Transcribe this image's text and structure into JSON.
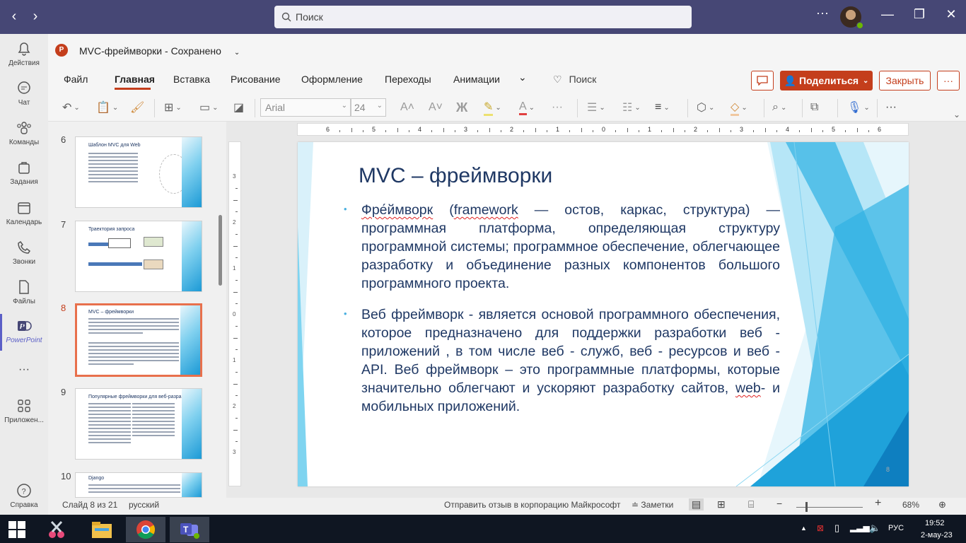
{
  "titlebar": {
    "search_placeholder": "Поиск",
    "more": "···"
  },
  "rail": {
    "items": [
      {
        "label": "Действия",
        "icon": "bell-icon"
      },
      {
        "label": "Чат",
        "icon": "chat-icon"
      },
      {
        "label": "Команды",
        "icon": "teams-icon"
      },
      {
        "label": "Задания",
        "icon": "assignments-icon"
      },
      {
        "label": "Календарь",
        "icon": "calendar-icon"
      },
      {
        "label": "Звонки",
        "icon": "phone-icon"
      },
      {
        "label": "Файлы",
        "icon": "file-icon"
      },
      {
        "label": "PowerPoint",
        "icon": "powerpoint-icon"
      },
      {
        "label": "···",
        "icon": "more-icon"
      },
      {
        "label": "Приложен...",
        "icon": "apps-icon"
      },
      {
        "label": "Справка",
        "icon": "help-icon"
      }
    ]
  },
  "document": {
    "title": "MVC-фреймворки",
    "separator": "-",
    "status": "Сохранено"
  },
  "ribbon": {
    "tabs": [
      "Файл",
      "Главная",
      "Вставка",
      "Рисование",
      "Оформление",
      "Переходы",
      "Анимации"
    ],
    "tell_me": "Поиск",
    "share": "Поделиться",
    "close": "Закрыть",
    "font_name": "Arial",
    "font_size": "24",
    "bold_glyph": "Ж"
  },
  "colors": {
    "accent": "#c43e1c",
    "teams": "#464775",
    "slide_text": "#1f3864",
    "selection": "#e8704c"
  },
  "thumbnails": [
    {
      "num": "6",
      "title": "Шаблон MVC для Web"
    },
    {
      "num": "7",
      "title": "Траектория запроса"
    },
    {
      "num": "8",
      "title": "MVC – фреймворки"
    },
    {
      "num": "9",
      "title": "Популярные фреймворки для веб-разработки"
    },
    {
      "num": "10",
      "title": "Django"
    }
  ],
  "ruler": {
    "h_ticks": [
      "6",
      "5",
      "4",
      "3",
      "2",
      "1",
      "0",
      "1",
      "2",
      "3",
      "4",
      "5",
      "6"
    ],
    "v_ticks": [
      "3",
      "2",
      "1",
      "0",
      "1",
      "2",
      "3"
    ]
  },
  "slide": {
    "title": "MVC – фреймворки",
    "bullet1_a": "Фре́ймворк",
    "bullet1_b": " (",
    "bullet1_c": "framework",
    "bullet1_d": " — остов, каркас, структура) — программная платформа, определяющая структуру программной системы; программное обеспечение, облегчающее разработку и объединение разных компонентов большого программного проекта.",
    "bullet2_a": "Веб фреймворк - является основой программного обеспечения, которое предназначено для поддержки разработки веб - приложений , в том числе веб - служб, веб - ресурсов и веб - API. Веб фреймворк – это программные платформы, которые значительно облегчают и ускоряют разработку сайтов, ",
    "bullet2_b": "web",
    "bullet2_c": "- и мобильных приложений.",
    "number": "8"
  },
  "status": {
    "slide_info": "Слайд 8 из 21",
    "language": "русский",
    "feedback": "Отправить отзыв в корпорацию Майкрософт",
    "notes": "Заметки",
    "zoom": "68%"
  },
  "taskbar": {
    "lang": "РУС",
    "time": "19:52",
    "date": "2-мау-23"
  }
}
